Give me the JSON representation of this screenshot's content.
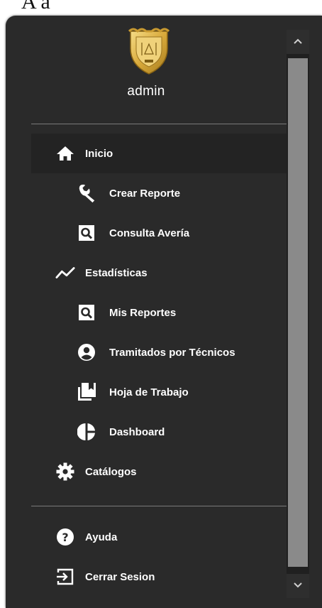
{
  "background": {
    "title_fragment": "A   á"
  },
  "profile": {
    "username": "admin",
    "badge_icon": "gold-police-shield-icon"
  },
  "menu": {
    "items": [
      {
        "label": "Inicio",
        "icon": "home-icon",
        "level": "top",
        "active": true
      },
      {
        "label": "Crear Reporte",
        "icon": "wrench-icon",
        "level": "sub"
      },
      {
        "label": "Consulta Avería",
        "icon": "search-document-icon",
        "level": "sub"
      },
      {
        "label": "Estadísticas",
        "icon": "trend-line-icon",
        "level": "top"
      },
      {
        "label": "Mis Reportes",
        "icon": "search-document-icon",
        "level": "sub"
      },
      {
        "label": "Tramitados por Técnicos",
        "icon": "account-circle-icon",
        "level": "sub"
      },
      {
        "label": "Hoja de Trabajo",
        "icon": "library-bookmark-icon",
        "level": "sub"
      },
      {
        "label": "Dashboard",
        "icon": "pie-chart-icon",
        "level": "sub"
      },
      {
        "label": "Catálogos",
        "icon": "gear-icon",
        "level": "top"
      }
    ],
    "footer": [
      {
        "label": "Ayuda",
        "icon": "help-circle-icon",
        "level": "top"
      },
      {
        "label": "Cerrar Sesion",
        "icon": "logout-icon",
        "level": "top"
      }
    ]
  },
  "colors": {
    "panel": "#2a2a2a",
    "active_row": "#232323",
    "text": "#ffffff",
    "badge_gold": "#e8c25a"
  }
}
